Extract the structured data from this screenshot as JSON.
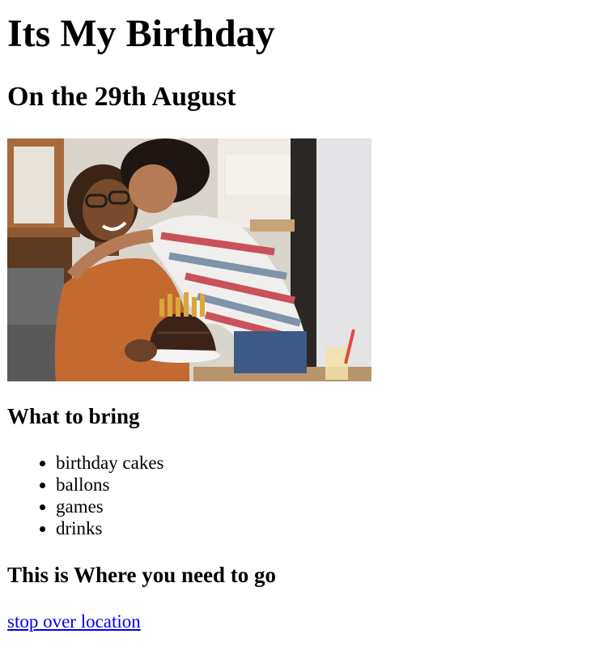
{
  "page": {
    "title": "Its My Birthday",
    "subtitle": "On the 29th August"
  },
  "bring": {
    "heading": "What to bring",
    "items": [
      "birthday cakes",
      "ballons",
      "games",
      "drinks"
    ]
  },
  "location": {
    "heading": "This is Where you need to go",
    "link_text": "stop over location"
  },
  "colors": {
    "link": "#0000ee",
    "text": "#000000",
    "background": "#ffffff"
  }
}
